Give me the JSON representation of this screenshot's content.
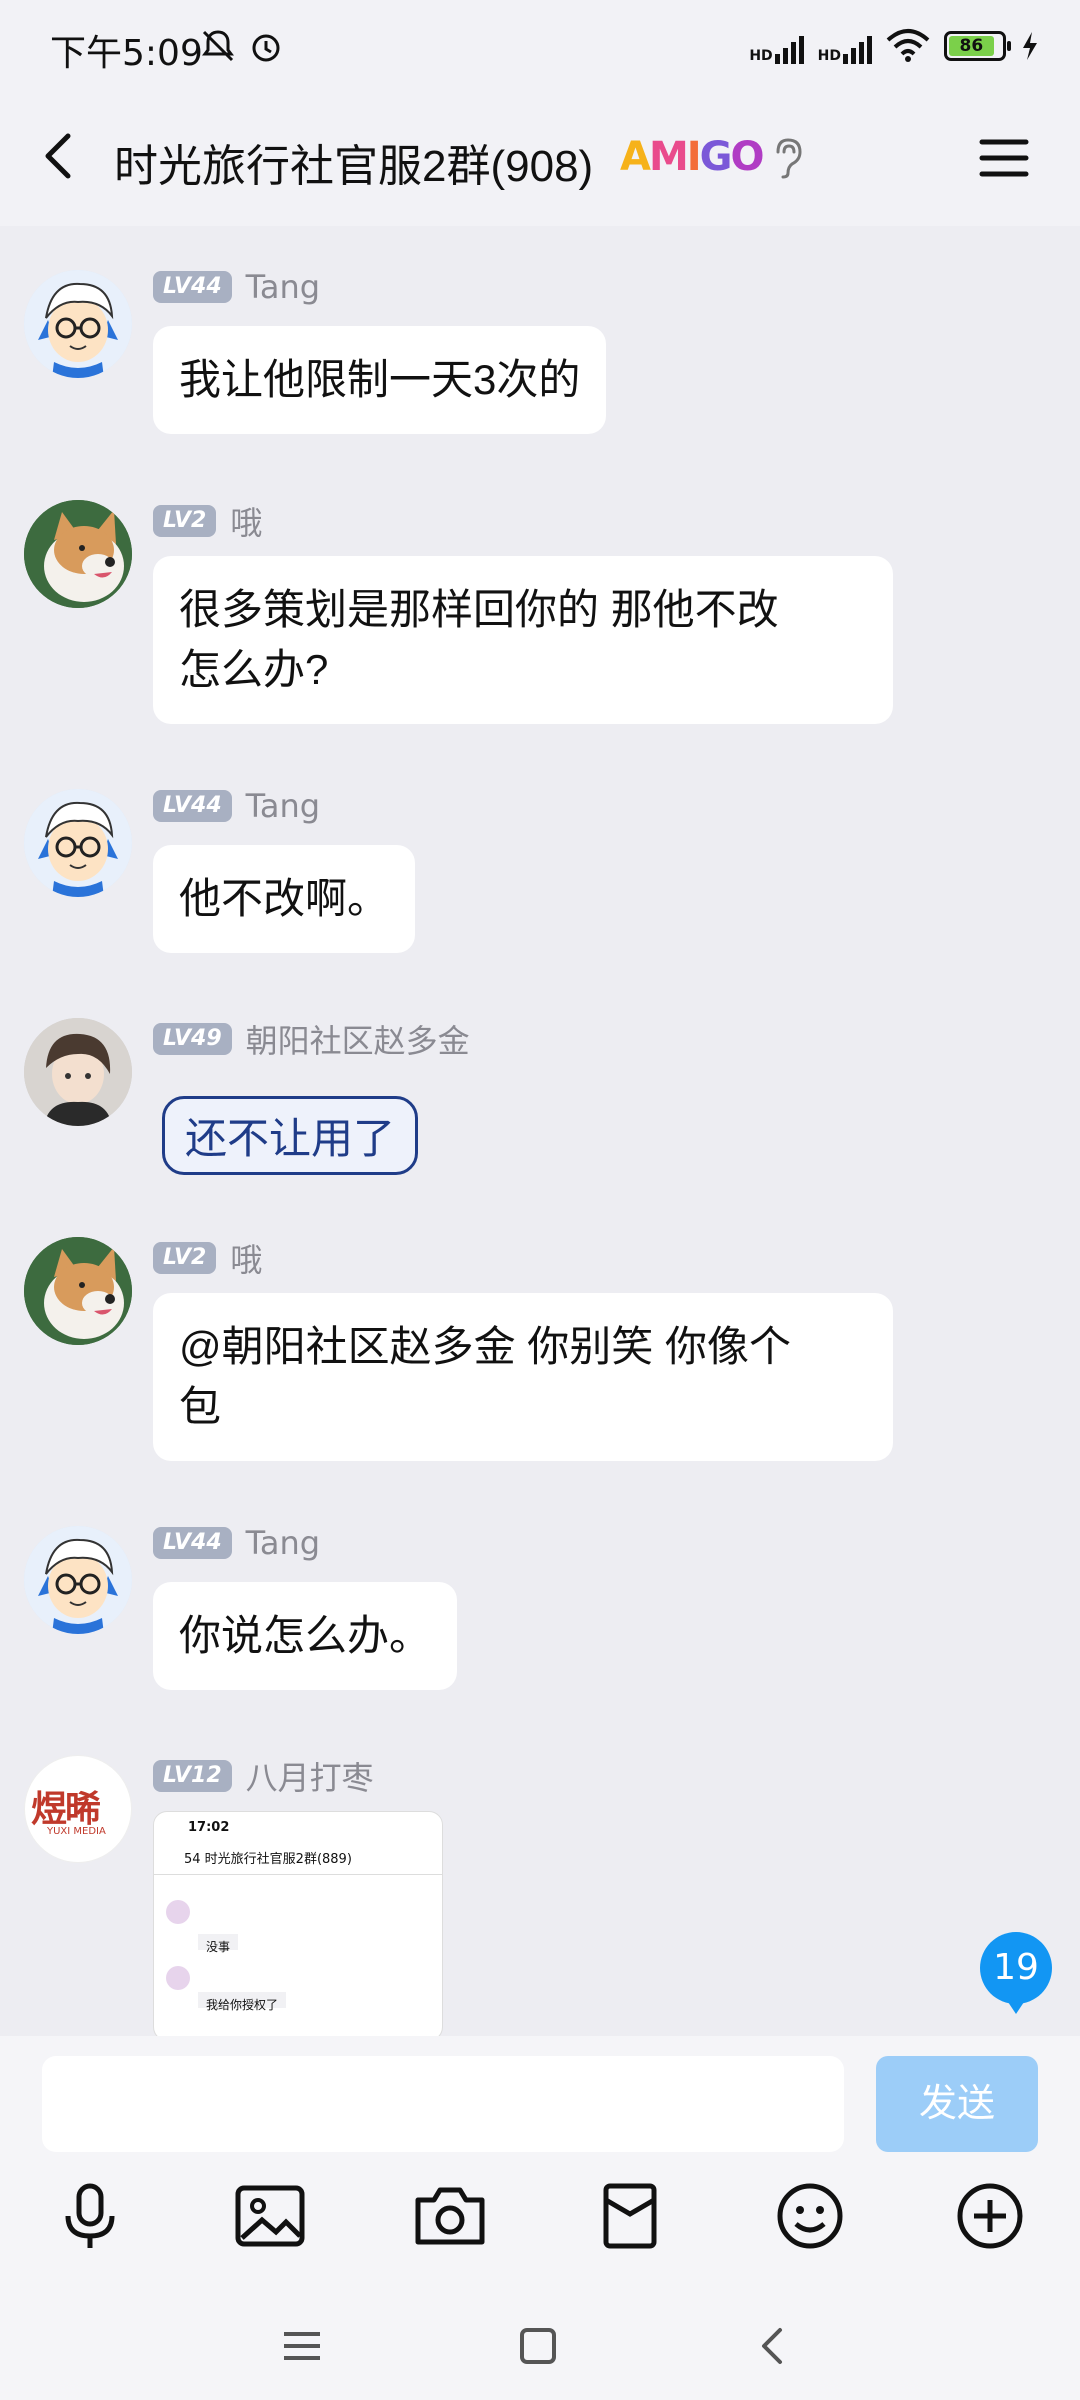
{
  "status_bar": {
    "time": "下午5:09",
    "signal1_label": "HD",
    "signal2_label": "HD",
    "battery": "86"
  },
  "header": {
    "title": "时光旅行社官服2群(908)",
    "badge": "AMIGO"
  },
  "messages": [
    {
      "level": "LV44",
      "name": "Tang",
      "text": "我让他限制一天3次的"
    },
    {
      "level": "LV2",
      "name": "哦",
      "text_line1": "很多策划是那样回你的 那他不改",
      "text_line2": "怎么办?"
    },
    {
      "level": "LV44",
      "name": "Tang",
      "text": "他不改啊。"
    },
    {
      "level": "LV49",
      "name": "朝阳社区赵多金",
      "text": "还不让用了"
    },
    {
      "level": "LV2",
      "name": "哦",
      "text_line1": "@朝阳社区赵多金 你别笑 你像个",
      "text_line2": "包"
    },
    {
      "level": "LV44",
      "name": "Tang",
      "text": "你说怎么办。"
    },
    {
      "level": "LV12",
      "name": "八月打枣",
      "image": {
        "time": "17:02",
        "title": "54  时光旅行社官服2群(889)",
        "line1": "没事",
        "line2": "我给你授权了"
      }
    }
  ],
  "avatar_logo_text": "煜晞",
  "avatar_logo_sub": "YUXI MEDIA",
  "unread_count": "19",
  "input": {
    "placeholder": "",
    "send_label": "发送"
  },
  "icons": [
    "mic-icon",
    "image-icon",
    "camera-icon",
    "red-packet-icon",
    "emoji-icon",
    "plus-icon"
  ],
  "colors": {
    "accent": "#1296f3",
    "send_disabled": "#9ccdf8",
    "level_badge": "#a8b0c2"
  }
}
